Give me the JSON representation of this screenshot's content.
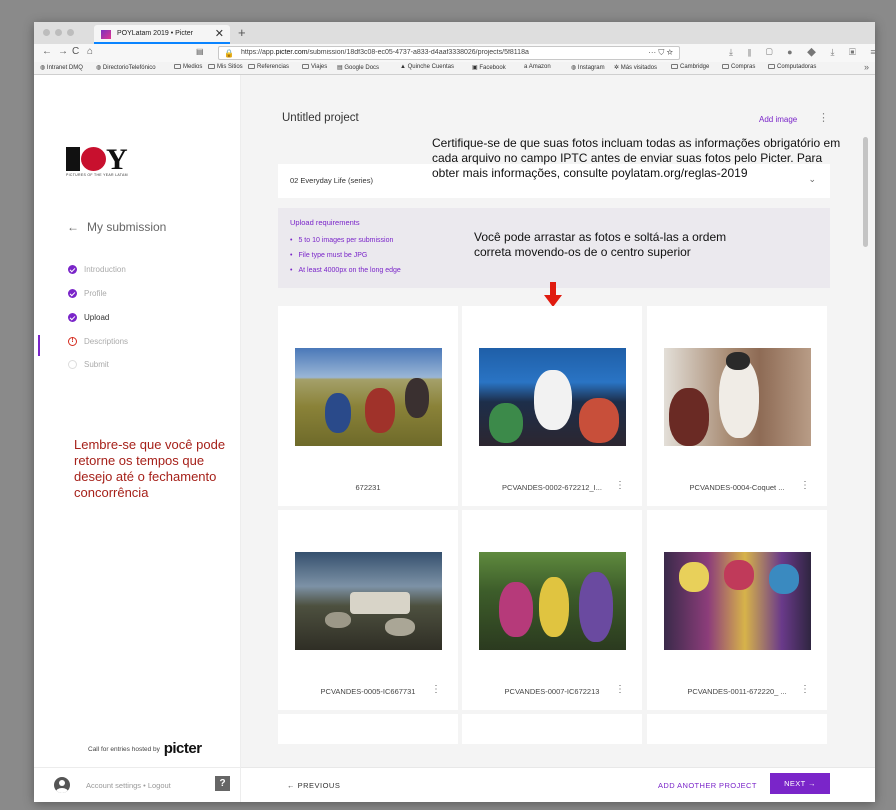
{
  "browser": {
    "tab_title": "POYLatam 2019 • Picter",
    "tab_close": "✕",
    "new_tab": "+",
    "url_prefix": "https://app.",
    "url_domain": "picter.com",
    "url_rest": "/submission/18df3c08-ec05-4737-a833-d4aaf3338026/projects/5f8118a",
    "url_actions": "··· ⛉ ☆",
    "nav_back": "←",
    "nav_forward": "→",
    "nav_reload": "C",
    "nav_home": "⌂",
    "bookmarks": [
      "Intranet DMQ",
      "DirectorioTelefónico",
      "Medios",
      "Mis Sitios",
      "Referencias",
      "Viajes",
      "Google Docs",
      "Quinche Cuentas",
      "Facebook",
      "Amazon",
      "Instagram",
      "Más visitados",
      "Cambridge",
      "Compras",
      "Computadoras"
    ],
    "bookmarks_more": "»"
  },
  "sidebar": {
    "logo_text": "POY",
    "logo_tagline": "PICTURES OF THE YEAR LATAM",
    "back_arrow": "←",
    "back_label": "My submission",
    "steps": [
      {
        "label": "Introduction",
        "status": "done"
      },
      {
        "label": "Profile",
        "status": "done"
      },
      {
        "label": "Upload",
        "status": "done"
      },
      {
        "label": "Descriptions",
        "status": "error"
      },
      {
        "label": "Submit",
        "status": "pending"
      }
    ],
    "reminder": "Lembre-se que você pode retorne os tempos que desejo até o fechamento concorrência",
    "hosted_prefix": "Call for entries hosted by",
    "hosted_brand": "picter",
    "account_links": "Account settings • Logout",
    "help": "?"
  },
  "main": {
    "project_title": "Untitled project",
    "add_image": "Add image",
    "kebab": "⋮",
    "category": "02 Everyday Life (series)",
    "category_chevron": "⌄",
    "note_iptc": "Certifique-se de que suas fotos incluam todas as informações obrigatório em cada arquivo no campo IPTC antes de enviar suas fotos pelo Picter. Para obter mais informações, consulte poylatam.org/reglas-2019",
    "requirements": {
      "heading": "Upload requirements",
      "items": [
        "5 to 10 images per submission",
        "File type must be JPG",
        "At least 4000px on the long edge"
      ]
    },
    "note_drag": "Você pode arrastar as fotos e soltá-las a ordem correta movendo-os de o centro superior",
    "images": [
      {
        "caption": "672231"
      },
      {
        "caption": "PCVANDES-0002-672212_I..."
      },
      {
        "caption": "PCVANDES-0004-Coquet ..."
      },
      {
        "caption": "PCVANDES-0005-IC667731"
      },
      {
        "caption": "PCVANDES-0007-IC672213"
      },
      {
        "caption": "PCVANDES-0011-672220_ ..."
      }
    ],
    "card_menu": "⋮"
  },
  "footer": {
    "previous": "← PREVIOUS",
    "add_project": "ADD ANOTHER PROJECT",
    "next": "NEXT →"
  },
  "colors": {
    "accent": "#7a25c9",
    "error": "#d52b1e",
    "annotation_red": "#a6211a",
    "arrow_red": "#e01b0f"
  }
}
